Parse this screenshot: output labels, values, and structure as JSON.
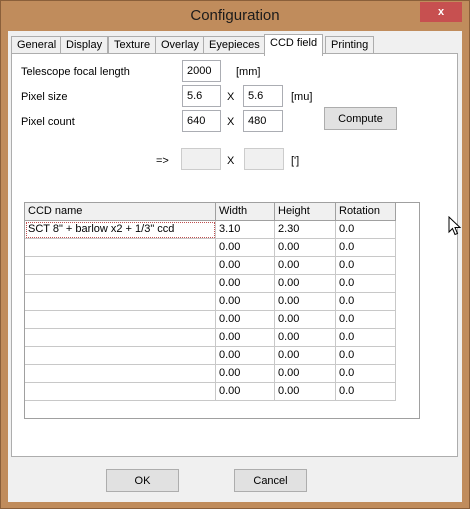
{
  "window": {
    "title": "Configuration",
    "close_label": "x"
  },
  "tabs": [
    {
      "label": "General"
    },
    {
      "label": "Display"
    },
    {
      "label": "Texture"
    },
    {
      "label": "Overlay"
    },
    {
      "label": "Eyepieces"
    },
    {
      "label": "CCD field"
    },
    {
      "label": "Printing"
    }
  ],
  "active_tab": "CCD field",
  "form": {
    "focal_label": "Telescope focal length",
    "focal_value": "2000",
    "focal_unit": "[mm]",
    "pixel_size_label": "Pixel size",
    "pixel_size_x": "5.6",
    "pixel_size_y": "5.6",
    "pixel_size_unit": "[mu]",
    "pixel_count_label": "Pixel count",
    "pixel_count_x": "640",
    "pixel_count_y": "480",
    "times": "X",
    "compute_label": "Compute",
    "result_arrow": "=>",
    "result_x": "",
    "result_y": "",
    "result_unit": "[']"
  },
  "grid": {
    "columns": [
      "CCD name",
      "Width",
      "Height",
      "Rotation"
    ],
    "rows": [
      [
        "SCT 8\" + barlow x2 + 1/3\" ccd",
        "3.10",
        "2.30",
        "0.0"
      ],
      [
        "",
        "0.00",
        "0.00",
        "0.0"
      ],
      [
        "",
        "0.00",
        "0.00",
        "0.0"
      ],
      [
        "",
        "0.00",
        "0.00",
        "0.0"
      ],
      [
        "",
        "0.00",
        "0.00",
        "0.0"
      ],
      [
        "",
        "0.00",
        "0.00",
        "0.0"
      ],
      [
        "",
        "0.00",
        "0.00",
        "0.0"
      ],
      [
        "",
        "0.00",
        "0.00",
        "0.0"
      ],
      [
        "",
        "0.00",
        "0.00",
        "0.0"
      ],
      [
        "",
        "0.00",
        "0.00",
        "0.0"
      ]
    ]
  },
  "buttons": {
    "ok_label": "OK",
    "cancel_label": "Cancel"
  }
}
